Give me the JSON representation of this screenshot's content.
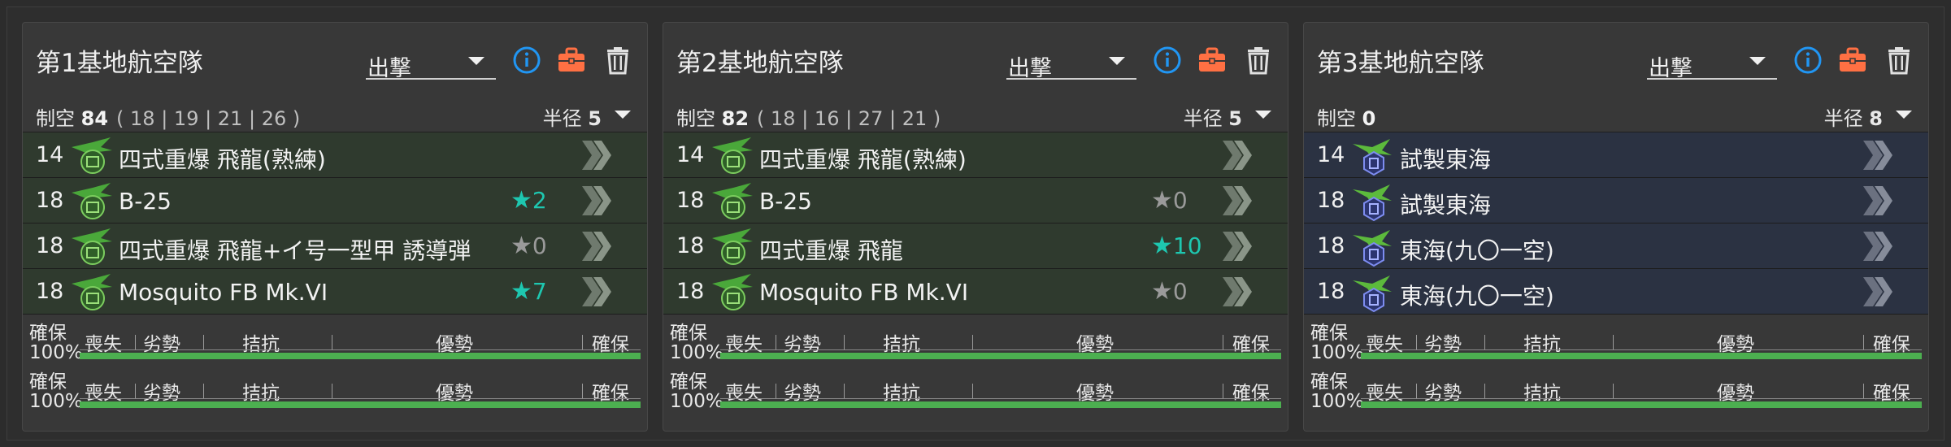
{
  "colors": {
    "info": "#2196f3",
    "bag": "#ff7043",
    "bar": "#4caf50",
    "star_teal": "#1ec7b0",
    "star_gray": "#9a9a9a"
  },
  "bar_labels": {
    "left_top": "確保",
    "left_bottom": "100%",
    "lost": "喪失",
    "inferior": "劣勢",
    "parity": "拮抗",
    "superior": "優勢",
    "supremacy": "確保"
  },
  "panels": [
    {
      "title": "第1基地航空隊",
      "mode": "出撃",
      "air_label": "制空",
      "air_value": "84",
      "air_breakdown": "( 18 | 19 | 21 | 26 )",
      "radius_label": "半径",
      "radius_value": "5",
      "slots": [
        {
          "count": "14",
          "name": "四式重爆 飛龍(熟練)",
          "icon": "army-bomber-icon",
          "level": ""
        },
        {
          "count": "18",
          "name": "B-25",
          "icon": "army-bomber-icon",
          "level": "2",
          "level_color": "teal"
        },
        {
          "count": "18",
          "name": "四式重爆 飛龍+イ号一型甲 誘導弾",
          "icon": "army-bomber-icon",
          "level": "0",
          "level_color": "gray"
        },
        {
          "count": "18",
          "name": "Mosquito FB Mk.VI",
          "icon": "army-bomber-icon",
          "level": "7",
          "level_color": "teal"
        }
      ],
      "bars": [
        1.0,
        1.0
      ]
    },
    {
      "title": "第2基地航空隊",
      "mode": "出撃",
      "air_label": "制空",
      "air_value": "82",
      "air_breakdown": "( 18 | 16 | 27 | 21 )",
      "radius_label": "半径",
      "radius_value": "5",
      "slots": [
        {
          "count": "14",
          "name": "四式重爆 飛龍(熟練)",
          "icon": "army-bomber-icon",
          "level": ""
        },
        {
          "count": "18",
          "name": "B-25",
          "icon": "army-bomber-icon",
          "level": "0",
          "level_color": "gray"
        },
        {
          "count": "18",
          "name": "四式重爆 飛龍",
          "icon": "army-bomber-icon",
          "level": "10",
          "level_color": "teal"
        },
        {
          "count": "18",
          "name": "Mosquito FB Mk.VI",
          "icon": "army-bomber-icon",
          "level": "0",
          "level_color": "gray"
        }
      ],
      "bars": [
        1.0,
        1.0
      ]
    },
    {
      "title": "第3基地航空隊",
      "mode": "出撃",
      "air_label": "制空",
      "air_value": "0",
      "air_breakdown": "",
      "radius_label": "半径",
      "radius_value": "8",
      "slots": [
        {
          "count": "14",
          "name": "試製東海",
          "icon": "patrol-plane-icon",
          "level": ""
        },
        {
          "count": "18",
          "name": "試製東海",
          "icon": "patrol-plane-icon",
          "level": ""
        },
        {
          "count": "18",
          "name": "東海(九〇一空)",
          "icon": "patrol-plane-icon",
          "level": ""
        },
        {
          "count": "18",
          "name": "東海(九〇一空)",
          "icon": "patrol-plane-icon",
          "level": ""
        }
      ],
      "bars": [
        1.0,
        1.0
      ]
    }
  ]
}
